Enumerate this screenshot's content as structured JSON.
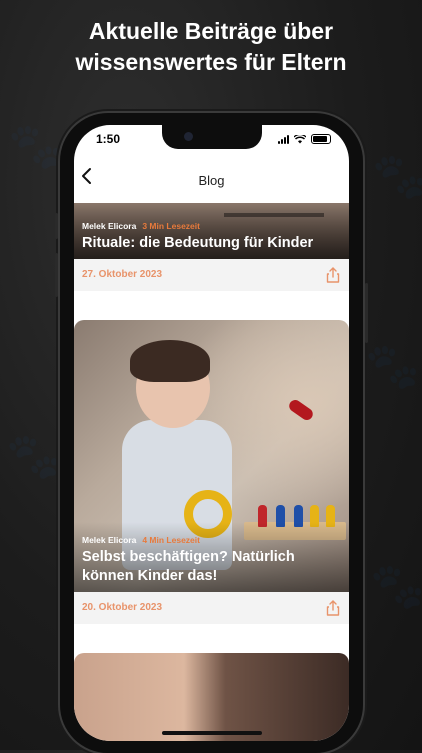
{
  "headline": {
    "line1": "Aktuelle Beiträge über",
    "line2": "wissenswertes für Eltern"
  },
  "status_bar": {
    "time": "1:50"
  },
  "nav": {
    "back_icon": "chevron-left-icon",
    "title": "Blog"
  },
  "posts": [
    {
      "author": "Melek Elicora",
      "read_time": "3 Min Lesezeit",
      "title": "Rituale: die Bedeutung für Kinder",
      "date": "27. Oktober 2023",
      "share_icon": "share-icon"
    },
    {
      "author": "Melek Elicora",
      "read_time": "4 Min Lesezeit",
      "title": "Selbst beschäftigen? Natürlich können Kinder das!",
      "date": "20. Oktober 2023",
      "share_icon": "share-icon"
    },
    {
      "author": "",
      "read_time": "",
      "title": "",
      "date": ""
    }
  ],
  "colors": {
    "accent": "#e87a3c",
    "date": "#e8936a",
    "background": "#1c1c1c"
  }
}
